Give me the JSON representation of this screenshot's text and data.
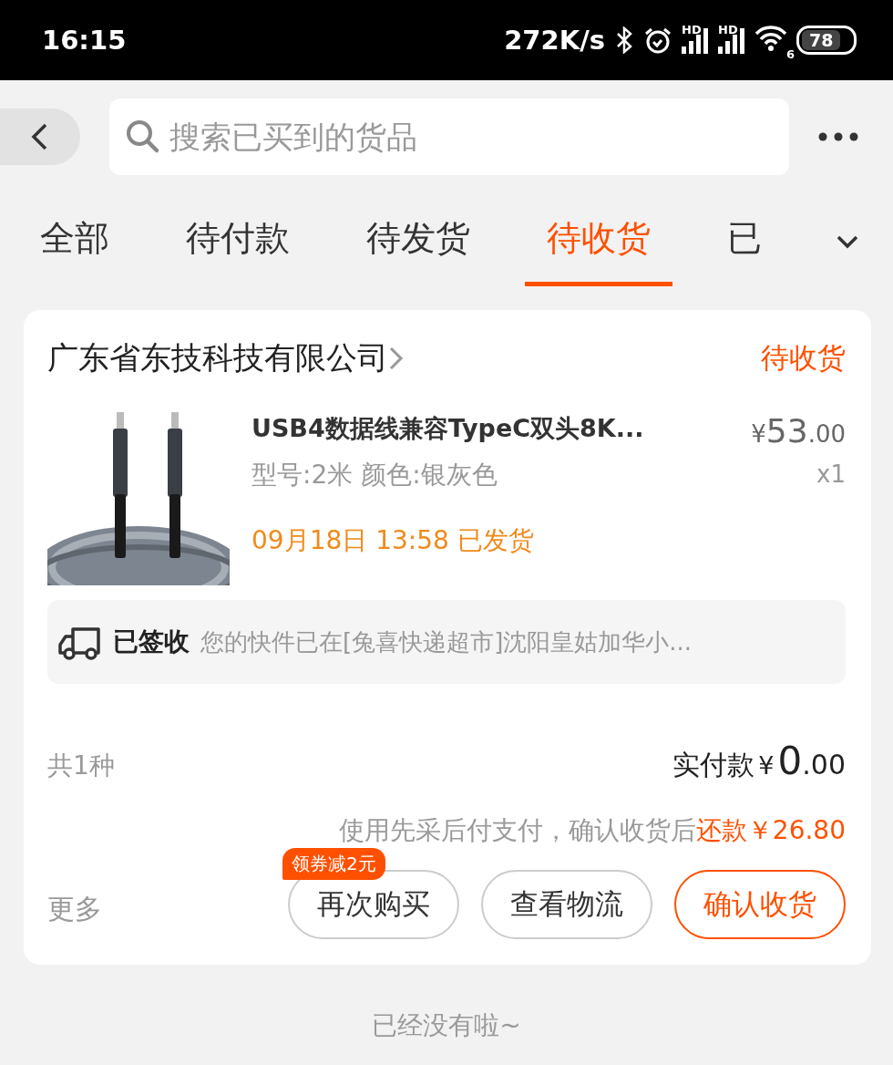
{
  "status_bar": {
    "time": "16:15",
    "speed": "272K/s",
    "signals": [
      {
        "label": "HD"
      },
      {
        "label": "HD"
      }
    ],
    "wifi_label": "6",
    "battery": "78"
  },
  "search": {
    "placeholder": "搜索已买到的货品"
  },
  "tabs": [
    {
      "label": "全部",
      "selected": false
    },
    {
      "label": "待付款",
      "selected": false
    },
    {
      "label": "待发货",
      "selected": false
    },
    {
      "label": "待收货",
      "selected": true
    },
    {
      "label": "已",
      "selected": false
    }
  ],
  "order": {
    "shop": "广东省东技科技有限公司",
    "status": "待收货",
    "product": {
      "kind": "picture",
      "title": "USB4数据线兼容TypeC双头8K...",
      "spec": "型号:2米 颜色:银灰色",
      "currency": "¥",
      "price_integer": "53",
      "price_decimals": ".00",
      "quantity": "x1",
      "shipping": "09月18日 13:58 已发货"
    },
    "logistics": {
      "status": "已签收",
      "message": "您的快件已在[兔喜快递超市]沈阳皇姑加华小..."
    },
    "count": "共1种",
    "paid": {
      "label": "实付款",
      "currency": "¥",
      "integer": "0",
      "decimals": ".00"
    },
    "note": {
      "text": "使用先采后付支付，确认收货后",
      "highlight": "还款￥26.80"
    },
    "more": "更多",
    "buttons": [
      {
        "label": "再次购买",
        "kind": "plain",
        "badge": "领券减2元"
      },
      {
        "label": "查看物流",
        "kind": "plain"
      },
      {
        "label": "确认收货",
        "kind": "primary"
      }
    ]
  },
  "footer": "已经没有啦~"
}
